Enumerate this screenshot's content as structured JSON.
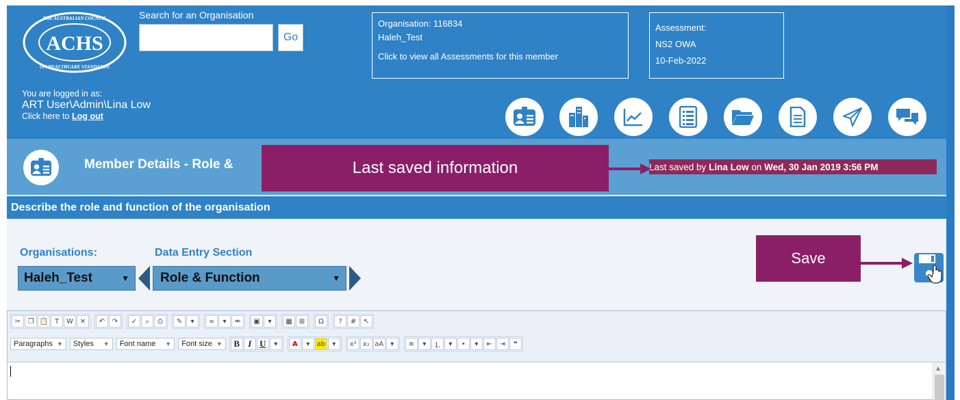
{
  "header": {
    "logo": {
      "text": "ACHS",
      "ring_text": "THE AUSTRALIAN COUNCIL ON HEALTHCARE STANDARDS"
    },
    "search": {
      "label": "Search for an Organisation",
      "value": "",
      "go_label": "Go"
    },
    "organisation": {
      "line1": "Organisation: 116834",
      "line2": "Haleh_Test",
      "line3": "Click to view all Assessments for this member"
    },
    "assessment": {
      "label": "Assessment:",
      "name": "NS2 OWA",
      "date": "10-Feb-2022"
    },
    "login": {
      "prefix": "You are logged in as:",
      "user": "ART User\\Admin\\Lina Low",
      "logout_prefix": "Click here to",
      "logout_link": "Log out"
    },
    "icons": [
      "member-details-icon",
      "organisation-structure-icon",
      "reports-chart-icon",
      "checklist-icon",
      "folder-icon",
      "document-icon",
      "send-icon",
      "chat-icon"
    ]
  },
  "subheader": {
    "title": "Member Details - Role &",
    "last_saved": {
      "prefix": "Last saved by",
      "user": "Lina Low",
      "middle": "on",
      "datetime": "Wed, 30 Jan 2019 3:56 PM"
    }
  },
  "callouts": {
    "last_saved": "Last saved information",
    "save": "Save"
  },
  "section_bar": {
    "title": "Describe the role and function of the organisation"
  },
  "selectors": {
    "organisations_label": "Organisations:",
    "organisation_value": "Haleh_Test",
    "section_label": "Data Entry Section",
    "section_value": "Role & Function"
  },
  "editor": {
    "toolbar": {
      "paragraphs": "Paragraphs",
      "styles": "Styles",
      "font_name": "Font name",
      "font_size": "Font size",
      "bold": "B",
      "italic": "I",
      "underline": "U"
    },
    "content": ""
  },
  "colors": {
    "header": "#2f82c5",
    "subheader": "#5aa0d2",
    "callout": "#8b1f67",
    "last_saved_bg": "#8d2a5a"
  }
}
